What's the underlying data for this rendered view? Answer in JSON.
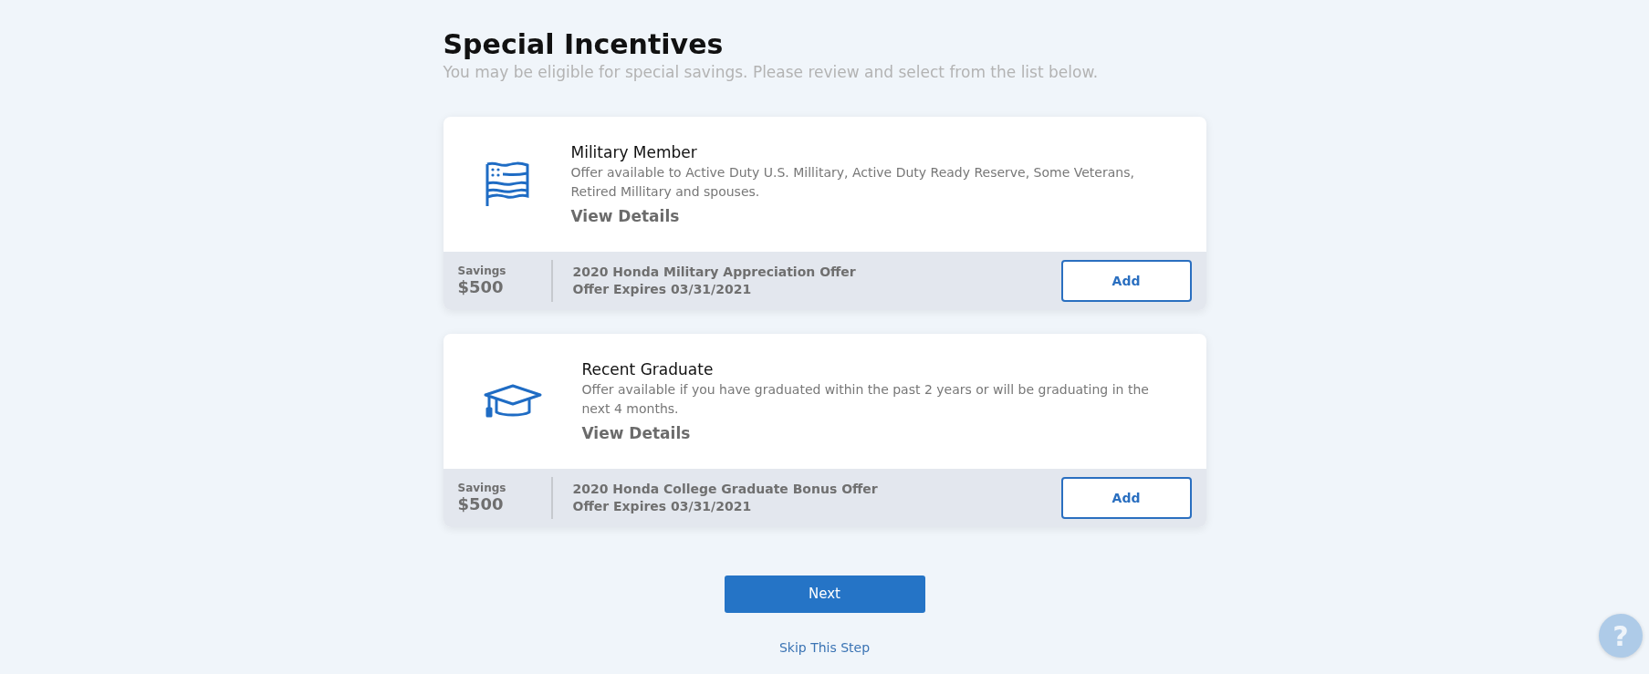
{
  "heading": {
    "title": "Special Incentives",
    "subtitle": "You may be eligible for special savings. Please review and select from the list below."
  },
  "offers": [
    {
      "kind": "military",
      "title": "Military Member",
      "description": "Offer available to Active Duty U.S. Millitary, Active Duty Ready Reserve, Some Veterans, Retired Millitary and spouses.",
      "details_link": "View Details",
      "savings_label": "Savings",
      "savings_amount": "$500",
      "offer_name": "2020 Honda Military Appreciation Offer",
      "expires": "Offer Expires 03/31/2021",
      "button": "Add"
    },
    {
      "kind": "graduate",
      "title": "Recent Graduate",
      "description": "Offer available if you have graduated within the past 2 years or will be graduating in the next 4 months.",
      "details_link": "View Details",
      "savings_label": "Savings",
      "savings_amount": "$500",
      "offer_name": "2020 Honda College Graduate Bonus Offer",
      "expires": "Offer Expires 03/31/2021",
      "button": "Add"
    }
  ],
  "next_button": "Next",
  "skip_link": "Skip This Step",
  "help_button": "?"
}
